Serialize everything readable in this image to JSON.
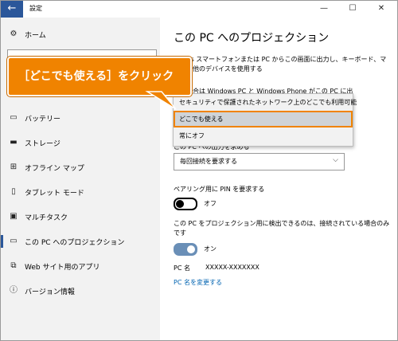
{
  "window": {
    "title": "設定",
    "back_icon": "←",
    "minimize": "—",
    "maximize": "☐",
    "close": "✕"
  },
  "sidebar": {
    "home": "ホーム",
    "items": [
      {
        "icon": "battery-icon",
        "label": "バッテリー"
      },
      {
        "icon": "storage-icon",
        "label": "ストレージ"
      },
      {
        "icon": "offline-map-icon",
        "label": "オフライン マップ"
      },
      {
        "icon": "tablet-mode-icon",
        "label": "タブレット モード"
      },
      {
        "icon": "multitask-icon",
        "label": "マルチタスク"
      },
      {
        "icon": "projection-icon",
        "label": "この PC へのプロジェクション"
      },
      {
        "icon": "web-apps-icon",
        "label": "Web サイト用のアプリ"
      },
      {
        "icon": "info-icon",
        "label": "バージョン情報"
      }
    ]
  },
  "main": {
    "title": "この PC へのプロジェクション",
    "desc_line1": "ndows スマートフォンまたは PC からこの画面に出力し、キーボード、マ",
    "desc_line2": "および他のデバイスを使用する",
    "desc_line3": "ない場合は Windows PC と Windows Phone がこの PC に出",
    "request_label": "この PC への出力を求める",
    "request_value": "毎回接続を要求する",
    "pin_label": "ペアリング用に PIN を要求する",
    "pin_toggle": "オフ",
    "detect_label": "この PC をプロジェクション用に検出できるのは、接続されている場合のみ",
    "detect_label2": "です",
    "detect_toggle": "オン",
    "pc_name_label": "PC 名",
    "pc_name_value": "XXXXX-XXXXXXX",
    "rename_link": "PC 名を変更する"
  },
  "dropdown": {
    "options": [
      "セキュリティで保護されたネットワーク上のどこでも利用可能",
      "どこでも使える",
      "常にオフ"
    ],
    "selected_index": 1
  },
  "callout": {
    "text": "［どこでも使える］をクリック"
  },
  "colors": {
    "accent": "#2b579a",
    "callout": "#f08300",
    "link": "#0063b1"
  }
}
